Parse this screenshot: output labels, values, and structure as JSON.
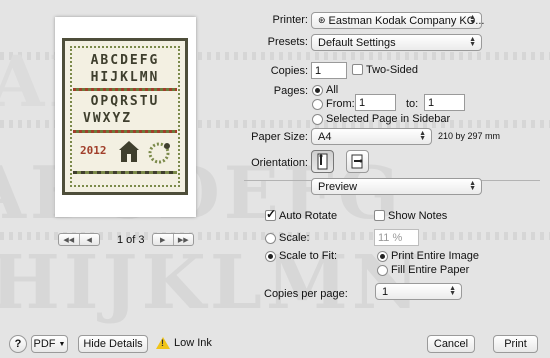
{
  "background_text": {
    "row1": "AB",
    "row2": "ABCDEFG",
    "row3": "HIJKLMN"
  },
  "preview": {
    "sampler_rows": [
      "ABCDEFG",
      "HIJKLMN",
      "OPQRSTU",
      "VWXYZ"
    ],
    "sampler_year": "2012",
    "page_indicator": "1 of 3"
  },
  "printer": {
    "label": "Printer:",
    "value": "Eastman Kodak Company KO..."
  },
  "presets": {
    "label": "Presets:",
    "value": "Default Settings"
  },
  "copies": {
    "label": "Copies:",
    "value": "1",
    "two_sided_label": "Two-Sided"
  },
  "pages": {
    "label": "Pages:",
    "all_label": "All",
    "from_label": "From:",
    "from_value": "1",
    "to_label": "to:",
    "to_value": "1",
    "selected_label": "Selected Page in Sidebar"
  },
  "paper_size": {
    "label": "Paper Size:",
    "value": "A4",
    "dimensions": "210 by 297 mm"
  },
  "orientation": {
    "label": "Orientation:"
  },
  "section": {
    "value": "Preview"
  },
  "preview_options": {
    "auto_rotate_label": "Auto Rotate",
    "show_notes_label": "Show Notes",
    "scale_label": "Scale:",
    "scale_value": "11 %",
    "scale_to_fit_label": "Scale to Fit:",
    "print_entire_label": "Print Entire Image",
    "fill_entire_label": "Fill Entire Paper",
    "copies_per_page_label": "Copies per page:",
    "copies_per_page_value": "1"
  },
  "bottom": {
    "help": "?",
    "pdf": "PDF",
    "hide_details": "Hide Details",
    "low_ink": "Low Ink",
    "cancel": "Cancel",
    "print": "Print"
  }
}
